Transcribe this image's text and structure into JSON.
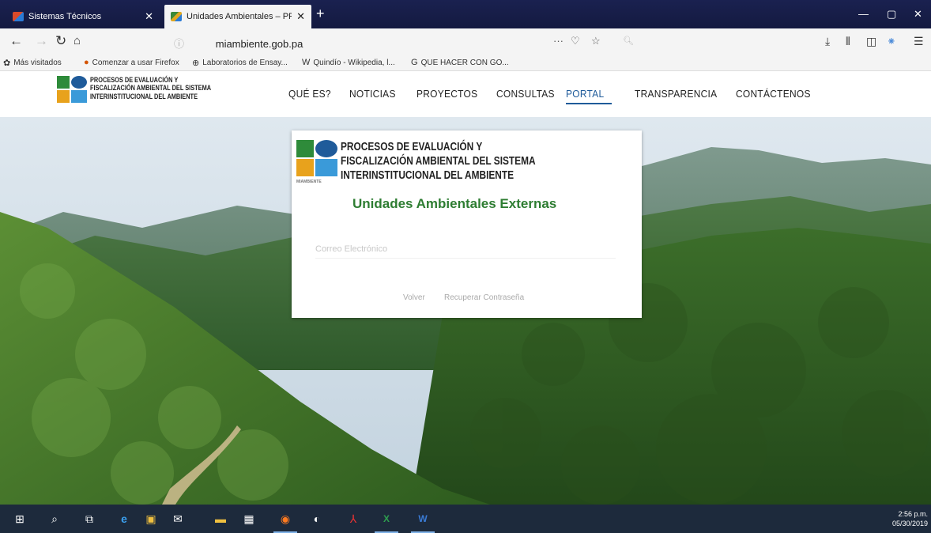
{
  "browser": {
    "tabs": [
      {
        "title": "Sistemas Técnicos",
        "active": false
      },
      {
        "title": "Unidades Ambientales – PRE",
        "active": true
      }
    ],
    "new_tab_label": "+",
    "url": {
      "host": "miambiente.gob.pa"
    },
    "bookmarks": [
      "Más visitados",
      "Comenzar a usar Firefox",
      "Laboratorios de Ensay...",
      "Quindío - Wikipedia, l...",
      "QUE HACER CON GO..."
    ]
  },
  "site": {
    "logo_lines": [
      "PROCESOS DE EVALUACIÓN Y",
      "FISCALIZACIÓN AMBIENTAL DEL SISTEMA",
      "INTERINSTITUCIONAL DEL AMBIENTE"
    ],
    "menu": [
      {
        "label": "QUÉ ES?",
        "active": false
      },
      {
        "label": "NOTICIAS",
        "active": false
      },
      {
        "label": "PROYECTOS",
        "active": false
      },
      {
        "label": "CONSULTAS",
        "active": false
      },
      {
        "label": "PORTAL",
        "active": true
      },
      {
        "label": "TRANSPARENCIA",
        "active": false
      },
      {
        "label": "CONTÁCTENOS",
        "active": false
      }
    ]
  },
  "login": {
    "logo_lines": [
      "PROCESOS DE EVALUACIÓN Y",
      "FISCALIZACIÓN AMBIENTAL DEL SISTEMA",
      "INTERINSTITUCIONAL DEL AMBIENTE"
    ],
    "logo_sub": "MIAMBIENTE",
    "title": "Unidades Ambientales Externas",
    "email_placeholder": "Correo Electrónico",
    "back_link": "Volver",
    "recover_link": "Recuperar Contraseña"
  },
  "taskbar": {
    "time": "2:56 p.m.",
    "date": "05/30/2019"
  },
  "colors": {
    "accent": "#1f5b9a",
    "title_green": "#2e7d32",
    "titlebar": "#1a2150",
    "taskbar": "#1d2a3c"
  }
}
